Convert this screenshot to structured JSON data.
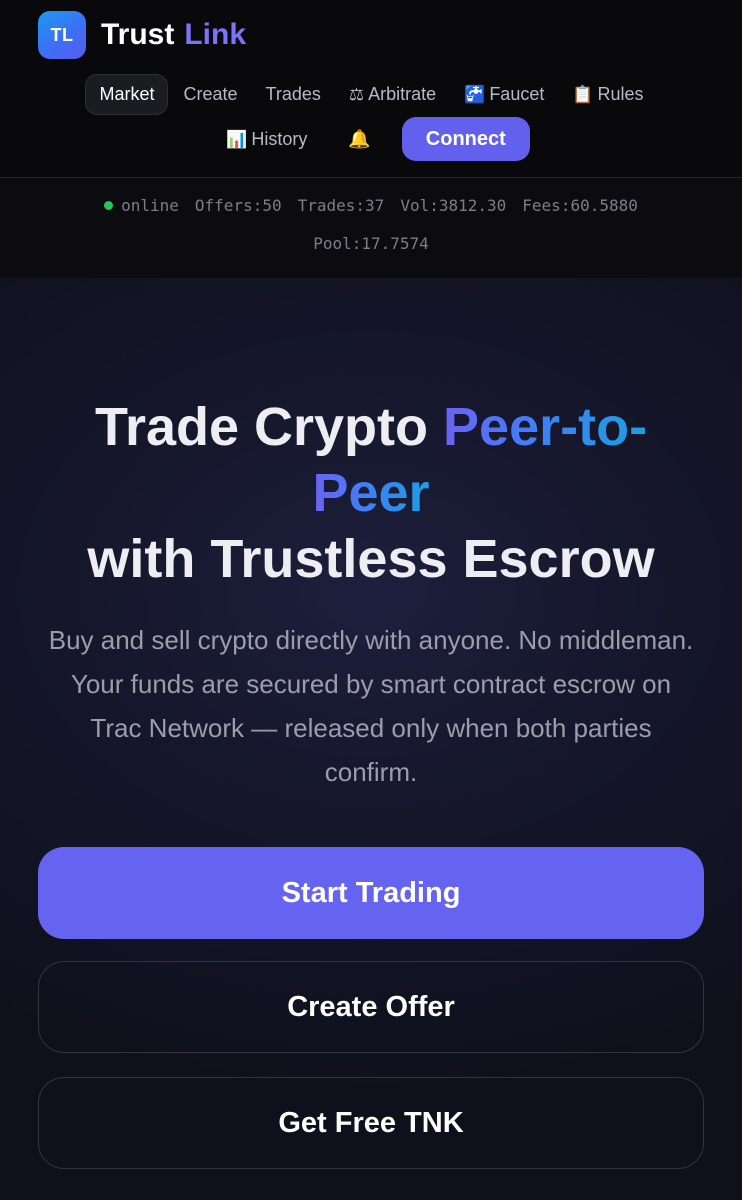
{
  "brand": {
    "logo_text": "TL",
    "name": "Trust",
    "name_accent": "Link"
  },
  "nav": {
    "items": [
      {
        "label": "Market",
        "icon": "",
        "active": true
      },
      {
        "label": "Create",
        "icon": ""
      },
      {
        "label": "Trades",
        "icon": ""
      },
      {
        "label": "Arbitrate",
        "icon": "⚖"
      },
      {
        "label": "Faucet",
        "icon": "🚰"
      },
      {
        "label": "Rules",
        "icon": "📋"
      },
      {
        "label": "History",
        "icon": "📊"
      }
    ],
    "bell_icon": "🔔",
    "connect_label": "Connect"
  },
  "status": {
    "state": "online",
    "offers": "Offers:50",
    "trades": "Trades:37",
    "volume": "Vol:3812.30",
    "fees": "Fees:60.5880",
    "pool": "Pool:17.7574"
  },
  "hero": {
    "title_part1": "Trade Crypto ",
    "title_highlight_a": "Peer-to-",
    "title_highlight_b": "Peer",
    "title_part2": "with Trustless Escrow",
    "subtitle": "Buy and sell crypto directly with anyone. No middleman. Your funds are secured by smart contract escrow on Trac Network — released only when both parties confirm."
  },
  "actions": {
    "start_trading": "Start Trading",
    "create_offer": "Create Offer",
    "free_tnk": "Get Free TNK"
  },
  "colors": {
    "accent": "#6464f0",
    "brand_accent": "#7b74f7",
    "status_online": "#22c55e",
    "gradient_start": "#6a63f2",
    "gradient_end": "#1ca0e0"
  }
}
